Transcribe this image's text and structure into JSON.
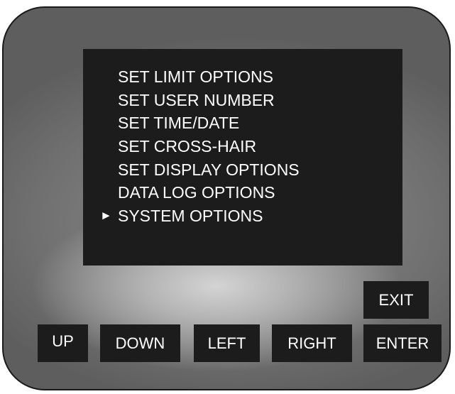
{
  "menu": {
    "items": [
      {
        "label": "SET LIMIT OPTIONS"
      },
      {
        "label": "SET USER NUMBER"
      },
      {
        "label": "SET TIME/DATE"
      },
      {
        "label": "SET CROSS-HAIR"
      },
      {
        "label": "SET DISPLAY OPTIONS"
      },
      {
        "label": "DATA LOG OPTIONS"
      },
      {
        "label": "SYSTEM OPTIONS"
      }
    ],
    "selected_index": 6,
    "selector_glyph": "►"
  },
  "keys": {
    "exit": "EXIT",
    "up": "UP",
    "down": "DOWN",
    "left": "LEFT",
    "right": "RIGHT",
    "enter": "ENTER"
  },
  "colors": {
    "screen_background": "#1c1c1c",
    "screen_text": "#ffffff",
    "device_body": "#7a7a7a",
    "device_highlight": "#d4d4d4",
    "key_background": "#1c1c1c"
  }
}
